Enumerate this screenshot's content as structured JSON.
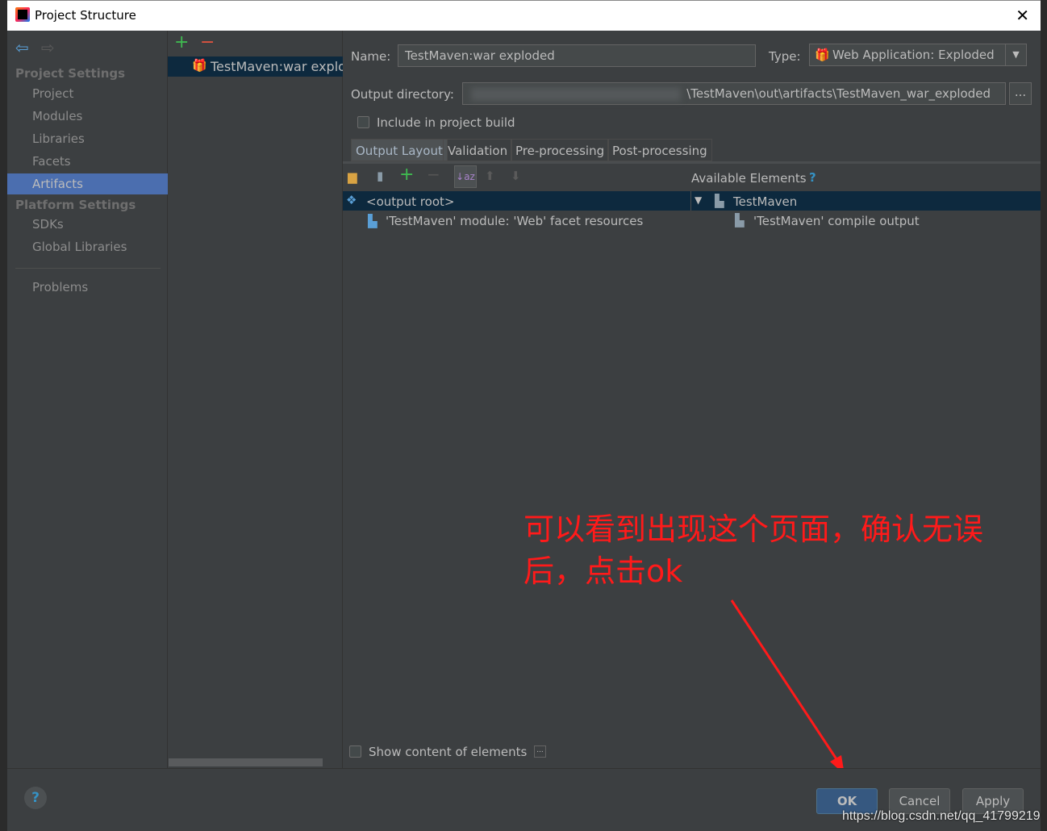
{
  "window": {
    "title": "Project Structure"
  },
  "sidebar": {
    "section1": "Project Settings",
    "items1": [
      "Project",
      "Modules",
      "Libraries",
      "Facets",
      "Artifacts"
    ],
    "section2": "Platform Settings",
    "items2": [
      "SDKs",
      "Global Libraries"
    ],
    "problems": "Problems",
    "selected": "Artifacts"
  },
  "artifacts": {
    "items": [
      "TestMaven:war exploded"
    ]
  },
  "form": {
    "name_label": "Name:",
    "name_value": "TestMaven:war exploded",
    "type_label": "Type:",
    "type_value": "Web Application: Exploded",
    "output_label": "Output directory:",
    "output_value": "\\TestMaven\\out\\artifacts\\TestMaven_war_exploded",
    "browse": "...",
    "include_label": "Include in project build",
    "include_checked": false
  },
  "tabs": [
    "Output Layout",
    "Validation",
    "Pre-processing",
    "Post-processing"
  ],
  "active_tab": "Output Layout",
  "layout": {
    "left_tree": [
      "<output root>",
      "'TestMaven' module: 'Web' facet resources"
    ],
    "available_label": "Available Elements",
    "help": "?",
    "right_tree": [
      "TestMaven",
      "'TestMaven' compile output"
    ],
    "show_content_label": "Show content of elements",
    "show_content_checked": false,
    "more": "..."
  },
  "annotation": {
    "line1": "可以看到出现这个页面，确认无误",
    "line2": "后，点击ok",
    "color": "#ff1a1a"
  },
  "buttons": {
    "help": "?",
    "ok": "OK",
    "cancel": "Cancel",
    "apply": "Apply"
  },
  "watermark": "https://blog.csdn.net/qq_41799219"
}
